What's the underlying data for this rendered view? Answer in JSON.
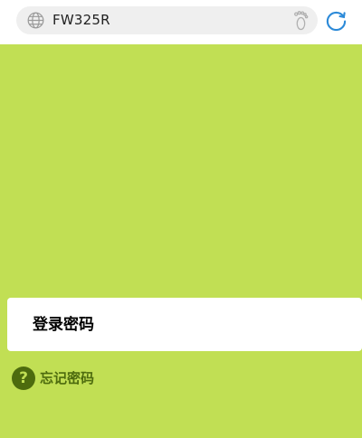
{
  "browser": {
    "url_text": "FW325R",
    "globe_icon": "globe-icon",
    "footprint_icon": "footprint-icon",
    "refresh_icon": "refresh-icon"
  },
  "login": {
    "password_placeholder": "登录密码",
    "forgot_label": "忘记密码",
    "forgot_icon_glyph": "?",
    "forgot_icon": "question-icon"
  },
  "colors": {
    "background": "#c1df54",
    "accent_dark": "#4d6b0e",
    "refresh_blue": "#2c8ad8"
  }
}
